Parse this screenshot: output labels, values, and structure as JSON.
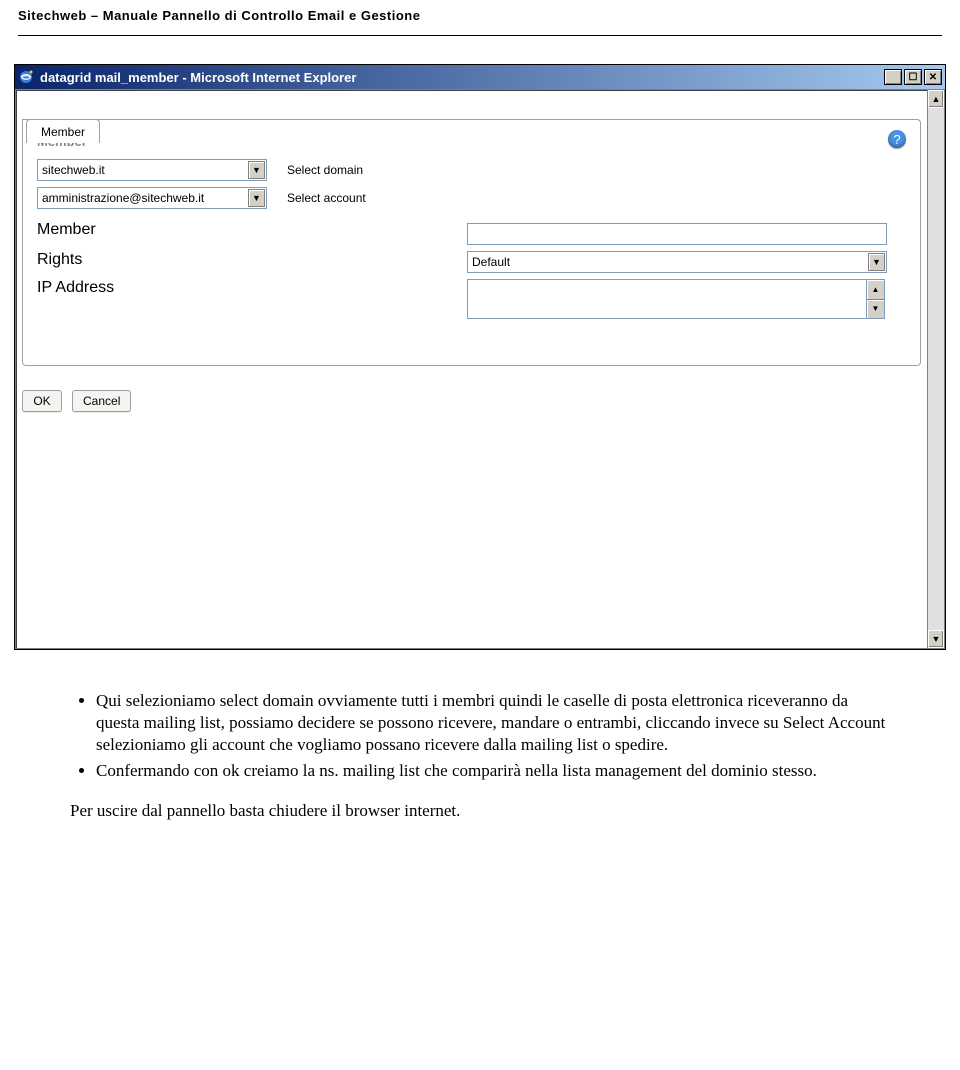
{
  "header": {
    "title": "Sitechweb – Manuale Pannello di Controllo Email e Gestione"
  },
  "window": {
    "title": "datagrid mail_member - Microsoft Internet Explorer",
    "tab_label": "Member",
    "panel_title": "Member",
    "help_tooltip": "?",
    "domain_select": "sitechweb.it",
    "domain_label": "Select domain",
    "account_select": "amministrazione@sitechweb.it",
    "account_label": "Select account",
    "member_label": "Member",
    "member_value": "",
    "rights_label": "Rights",
    "rights_value": "Default",
    "ip_label": "IP Address",
    "ip_value": "",
    "ok_label": "OK",
    "cancel_label": "Cancel"
  },
  "prose": {
    "bullet1": "Qui selezioniamo select domain ovviamente tutti i membri quindi le caselle di posta elettronica riceveranno da questa mailing list, possiamo decidere se possono ricevere, mandare o entrambi, cliccando invece su Select Account selezioniamo gli account che vogliamo possano ricevere dalla mailing list o spedire.",
    "bullet2": "Confermando con ok creiamo la ns. mailing list che comparirà nella lista management del dominio stesso.",
    "footer": "Per uscire dal pannello basta chiudere il browser internet."
  }
}
